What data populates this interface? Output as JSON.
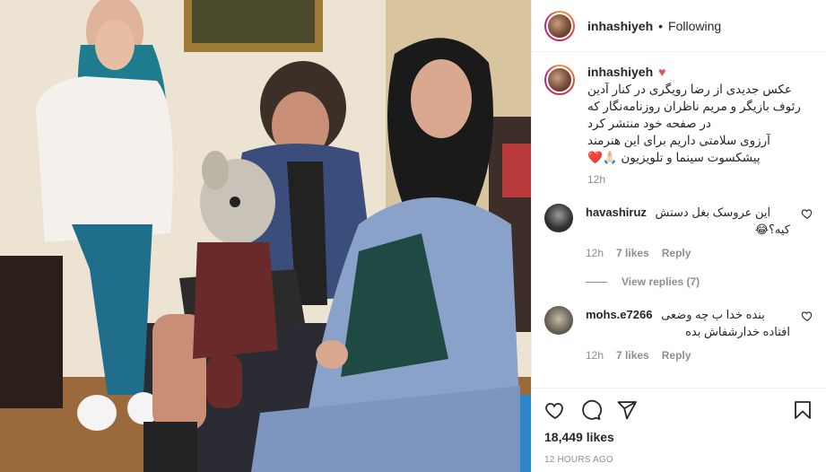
{
  "post": {
    "username": "inhashiyeh",
    "follow_status": "Following",
    "separator": "•"
  },
  "caption": {
    "username": "inhashiyeh",
    "lines": [
      "عکس جدیدی از رضا رویگری در کنار آدین",
      "رئوف بازیگر و مریم ناظران روزنامه‌نگار که",
      "در صفحه خود منتشر کرد",
      "آرزوی سلامتی داریم برای این هنرمند",
      "پیشکسوت سینما و تلویزیون 🙏🏻❤️"
    ],
    "time": "12h"
  },
  "comments": [
    {
      "username": "havashiruz",
      "text_lines": [
        "این عروسک بغل دستش",
        "کیه؟😂"
      ],
      "time": "12h",
      "likes": "7 likes",
      "reply": "Reply",
      "avatar_color": "#3a3a3a"
    },
    {
      "username": "mohs.e7266",
      "text_lines": [
        "بنده خدا ب چه وضعی",
        "افتاده خدارشفاش بده"
      ],
      "time": "12h",
      "likes": "7 likes",
      "reply": "Reply",
      "avatar_color": "#8a8a7a"
    }
  ],
  "view_replies": "View replies (7)",
  "footer": {
    "likes": "18,449 likes",
    "time_ago": "12 HOURS AGO"
  },
  "icons": {
    "like": "heart-outline-icon",
    "comment": "comment-bubble-icon",
    "share": "paper-plane-icon",
    "save": "bookmark-icon",
    "caption_heart": "red-heart-icon"
  },
  "colors": {
    "red_heart": "#ed4956",
    "muted": "#8e8e8e",
    "text": "#262626"
  }
}
